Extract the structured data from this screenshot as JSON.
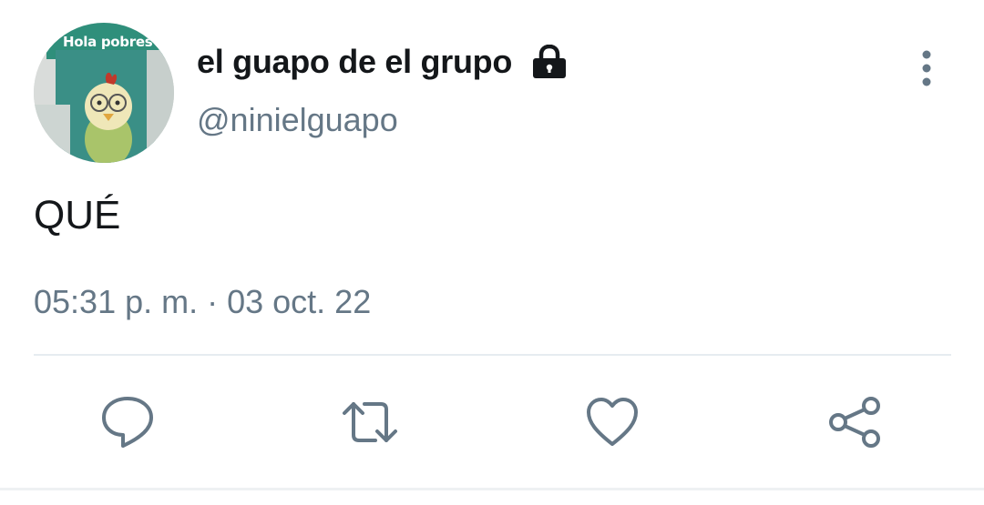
{
  "tweet": {
    "avatar": {
      "caption": "Hola pobres",
      "icon": "profile-picture"
    },
    "display_name": "el guapo de el grupo",
    "protected_icon": "lock-icon",
    "handle": "@ninielguapo",
    "text": "QUÉ",
    "timestamp": "05:31 p. m. · 03 oct. 22",
    "menu_icon": "more-vertical-icon",
    "actions": [
      {
        "name": "reply",
        "icon": "reply-icon"
      },
      {
        "name": "retweet",
        "icon": "retweet-icon"
      },
      {
        "name": "like",
        "icon": "heart-icon"
      },
      {
        "name": "share",
        "icon": "share-icon"
      }
    ]
  },
  "colors": {
    "primary_text": "#14171a",
    "secondary_text": "#657786",
    "icon": "#657786",
    "divider": "#e6ecf0",
    "background": "#ffffff"
  }
}
